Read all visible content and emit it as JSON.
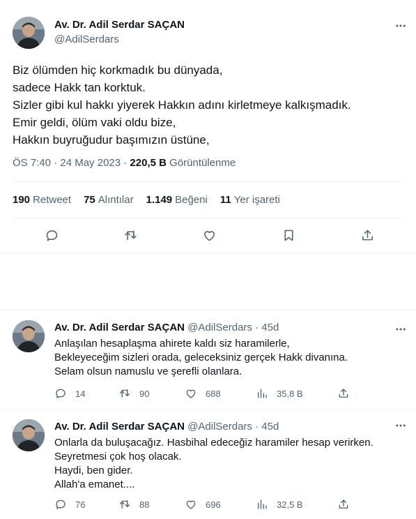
{
  "main_tweet": {
    "author_name": "Av. Dr. Adil Serdar SAÇAN",
    "author_handle": "@AdilSerdars",
    "more_icon": "more-horizontal-icon",
    "lines": [
      "Biz ölümden hiç korkmadık bu dünyada,",
      "sadece Hakk tan korktuk.",
      "Sizler gibi kul hakkı yiyerek Hakkın adını kirletmeye kalkışmadık.",
      "Emir geldi, ölüm vaki oldu bize,",
      "Hakkın buyruğudur başımızın üstüne,"
    ],
    "time": "ÖS 7:40 · 24 May 2023 · ",
    "views_count": "220,5 B",
    "views_label": " Görüntülenme",
    "stats": {
      "retweet_count": "190",
      "retweet_label": "Retweet",
      "quote_count": "75",
      "quote_label": "Alıntılar",
      "like_count": "1.149",
      "like_label": "Beğeni",
      "bookmark_count": "11",
      "bookmark_label": "Yer işareti"
    },
    "action_icons": [
      "reply-icon",
      "retweet-icon",
      "like-icon",
      "bookmark-icon",
      "share-icon"
    ]
  },
  "replies": [
    {
      "name": "Av. Dr. Adil Serdar SAÇAN",
      "meta": " @AdilSerdars · 45d",
      "lines": [
        "Anlaşılan hesaplaşma ahirete kaldı siz haramilerle,",
        "Bekleyeceğim sizleri orada, geleceksiniz gerçek Hakk divanına.",
        "Selam olsun namuslu ve şerefli olanlara."
      ],
      "replies": "14",
      "retweets": "90",
      "likes": "688",
      "views": "35,8 B"
    },
    {
      "name": "Av. Dr. Adil Serdar SAÇAN",
      "meta": " @AdilSerdars · 45d",
      "lines": [
        "Onlarla da buluşacağız. Hasbihal edeceğiz haramiler hesap verirken.",
        "Seyretmesi çok hoş olacak.",
        "Haydi, ben gider.",
        "Allah'a emanet...."
      ],
      "replies": "76",
      "retweets": "88",
      "likes": "696",
      "views": "32,5 B"
    }
  ],
  "colors": {
    "text": "#0f1419",
    "secondary": "#536471",
    "divider": "#eff3f4"
  }
}
